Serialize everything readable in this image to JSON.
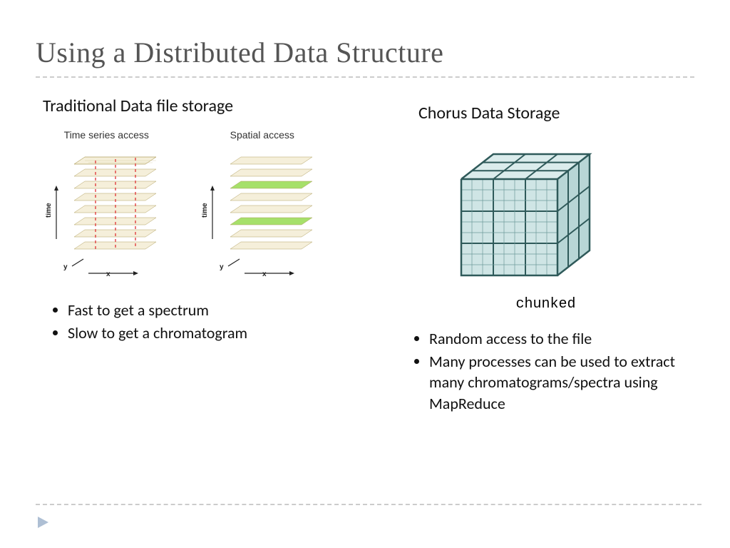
{
  "title": "Using a Distributed Data Structure",
  "left": {
    "heading": "Traditional Data file storage",
    "fig_labels": {
      "a": "Time series access",
      "b": "Spatial access"
    },
    "axes": {
      "time": "time",
      "x": "x",
      "y": "y"
    },
    "bullets": [
      "Fast to get a spectrum",
      "Slow to get a chromatogram"
    ]
  },
  "right": {
    "heading": "Chorus Data Storage",
    "caption": "chunked",
    "bullets": [
      "Random access to the file",
      "Many processes can be used to extract many chromatograms/spectra using MapReduce"
    ]
  },
  "icons": {
    "nav_arrow": "nav-arrow"
  }
}
